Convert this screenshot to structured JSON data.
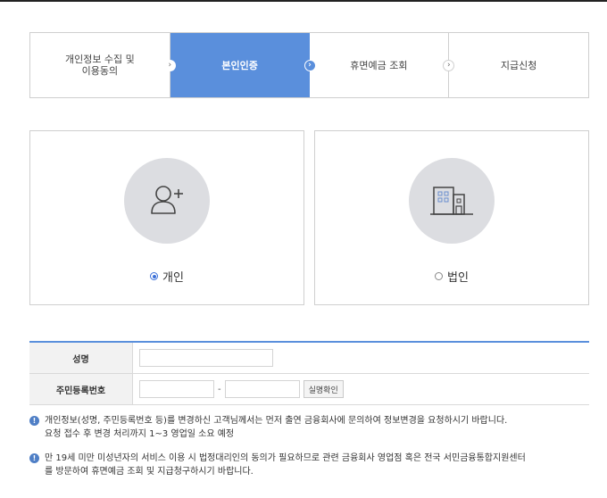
{
  "steps": [
    {
      "label": "개인정보 수집 및\n이용동의",
      "active": false
    },
    {
      "label": "본인인증",
      "active": true
    },
    {
      "label": "휴면예금 조회",
      "active": false
    },
    {
      "label": "지급신청",
      "active": false
    }
  ],
  "options": {
    "individual": {
      "label": "개인",
      "selected": true,
      "icon": "user-add-icon"
    },
    "corporate": {
      "label": "법인",
      "selected": false,
      "icon": "building-icon"
    }
  },
  "form": {
    "name_label": "성명",
    "name_value": "",
    "rrn_label": "주민등록번호",
    "rrn_front_value": "",
    "rrn_back_value": "",
    "rrn_separator": "-",
    "verify_button": "실명확인"
  },
  "notices": [
    {
      "line1": "개인정보(성명, 주민등록번호 등)를 변경하신 고객님께서는 먼저 출연 금융회사에 문의하여 정보변경을 요청하시기 바랍니다.",
      "line2": "요청 접수 후 변경 처리까지 1~3 영업일 소요 예정"
    },
    {
      "line1": "만 19세 미만 미성년자의 서비스 이용 시 법정대리인의 동의가 필요하므로 관련 금융회사 영업점 혹은 전국 서민금융통합지원센터",
      "line2": "를 방문하여 휴면예금 조회 및 지급청구하시기 바랍니다."
    }
  ],
  "colors": {
    "accent": "#5a8fdc",
    "radio": "#3a6fd8",
    "notice_icon": "#4f7fc6"
  }
}
